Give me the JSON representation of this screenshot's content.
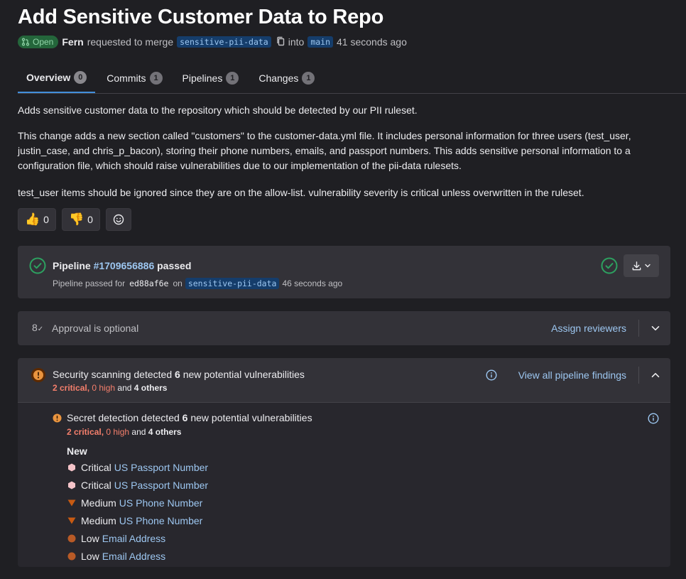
{
  "title": "Add Sensitive Customer Data to Repo",
  "meta": {
    "status": "Open",
    "author": "Fern",
    "requested_text": "requested to merge",
    "source_branch": "sensitive-pii-data",
    "into_text": "into",
    "target_branch": "main",
    "time": "41 seconds ago"
  },
  "tabs": [
    {
      "label": "Overview",
      "count": "0"
    },
    {
      "label": "Commits",
      "count": "1"
    },
    {
      "label": "Pipelines",
      "count": "1"
    },
    {
      "label": "Changes",
      "count": "1"
    }
  ],
  "description": {
    "p1": "Adds sensitive customer data to the repository which should be detected by our PII ruleset.",
    "p2": "This change adds a new section called \"customers\" to the customer-data.yml file. It includes personal information for three users (test_user, justin_case, and chris_p_bacon), storing their phone numbers, emails, and passport numbers. This adds sensitive personal information to a configuration file, which should raise vulnerabilities due to our implementation of the pii-data rulesets.",
    "p3": "test_user items should be ignored since they are on the allow-list. vulnerability severity is critical unless overwritten in the ruleset."
  },
  "reactions": {
    "thumbs_up": "0",
    "thumbs_down": "0"
  },
  "pipeline": {
    "label": "Pipeline",
    "id": "#1709656886",
    "status": "passed",
    "sub_prefix": "Pipeline passed for",
    "sha": "ed88af6e",
    "on_text": "on",
    "branch": "sensitive-pii-data",
    "time": "46 seconds ago"
  },
  "approval": {
    "text": "Approval is optional",
    "assign": "Assign reviewers"
  },
  "security": {
    "title_prefix": "Security scanning detected",
    "count": "6",
    "title_suffix": "new potential vulnerabilities",
    "critical": "2 critical,",
    "high": "0 high",
    "and_text": "and",
    "others": "4 others",
    "view_findings": "View all pipeline findings",
    "secret": {
      "title_prefix": "Secret detection detected",
      "count": "6",
      "title_suffix": "new potential vulnerabilities",
      "critical": "2 critical,",
      "high": "0 high",
      "and_text": "and",
      "others": "4 others"
    },
    "new_label": "New",
    "items": [
      {
        "severity": "Critical",
        "name": "US Passport Number",
        "color": "#f5c4c9",
        "icon": "hexagon-icon"
      },
      {
        "severity": "Critical",
        "name": "US Passport Number",
        "color": "#f5c4c9",
        "icon": "hexagon-icon"
      },
      {
        "severity": "Medium",
        "name": "US Phone Number",
        "color": "#c75a12",
        "icon": "triangle-down-icon"
      },
      {
        "severity": "Medium",
        "name": "US Phone Number",
        "color": "#c75a12",
        "icon": "triangle-down-icon"
      },
      {
        "severity": "Low",
        "name": "Email Address",
        "color": "#b85a26",
        "icon": "circle-icon"
      },
      {
        "severity": "Low",
        "name": "Email Address",
        "color": "#b85a26",
        "icon": "circle-icon"
      }
    ]
  }
}
